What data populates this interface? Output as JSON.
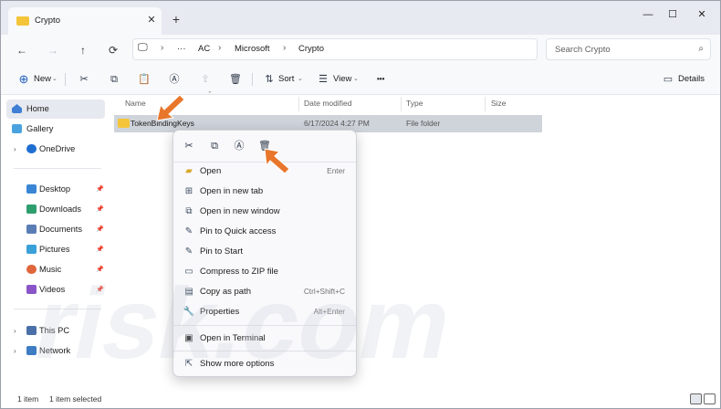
{
  "window": {
    "tab_title": "Crypto",
    "tab_close_glyph": "✕",
    "new_tab_glyph": "+",
    "minimize_glyph": "—",
    "maximize_glyph": "☐",
    "close_glyph": "✕"
  },
  "address": {
    "crumbs": [
      "AC",
      "Microsoft",
      "Crypto"
    ],
    "search_placeholder": "Search Crypto"
  },
  "toolbar": {
    "new_label": "New",
    "sort_label": "Sort",
    "view_label": "View",
    "more_glyph": "•••",
    "details_label": "Details"
  },
  "sidebar": {
    "items": [
      {
        "label": "Home",
        "icon": "home-icon"
      },
      {
        "label": "Gallery",
        "icon": "gallery-icon"
      },
      {
        "label": "OneDrive",
        "icon": "cloud-icon"
      },
      {
        "label": "Desktop",
        "icon": "desktop-icon"
      },
      {
        "label": "Downloads",
        "icon": "download-icon"
      },
      {
        "label": "Documents",
        "icon": "document-icon"
      },
      {
        "label": "Pictures",
        "icon": "picture-icon"
      },
      {
        "label": "Music",
        "icon": "music-icon"
      },
      {
        "label": "Videos",
        "icon": "video-icon"
      },
      {
        "label": "This PC",
        "icon": "pc-icon"
      },
      {
        "label": "Network",
        "icon": "network-icon"
      }
    ]
  },
  "columns": {
    "name": "Name",
    "date": "Date modified",
    "type": "Type",
    "size": "Size"
  },
  "files": [
    {
      "name": "TokenBindingKeys",
      "date": "6/17/2024 4:27 PM",
      "type": "File folder",
      "size": ""
    }
  ],
  "status": {
    "count": "1 item",
    "selected": "1 item selected"
  },
  "context_menu": {
    "top_icons": [
      "cut-icon",
      "copy-icon",
      "rename-icon",
      "delete-icon"
    ],
    "items": [
      {
        "label": "Open",
        "shortcut": "Enter",
        "icon": "open-folder-icon"
      },
      {
        "label": "Open in new tab",
        "shortcut": "",
        "icon": "new-tab-icon"
      },
      {
        "label": "Open in new window",
        "shortcut": "",
        "icon": "new-window-icon"
      },
      {
        "label": "Pin to Quick access",
        "shortcut": "",
        "icon": "pin-icon"
      },
      {
        "label": "Pin to Start",
        "shortcut": "",
        "icon": "pin-icon"
      },
      {
        "label": "Compress to ZIP file",
        "shortcut": "",
        "icon": "zip-icon"
      },
      {
        "label": "Copy as path",
        "shortcut": "Ctrl+Shift+C",
        "icon": "path-icon"
      },
      {
        "label": "Properties",
        "shortcut": "Alt+Enter",
        "icon": "wrench-icon"
      },
      {
        "label": "Open in Terminal",
        "shortcut": "",
        "icon": "terminal-icon"
      },
      {
        "label": "Show more options",
        "shortcut": "",
        "icon": "more-options-icon"
      }
    ]
  },
  "colors": {
    "accent_arrow": "#e8762b",
    "folder": "#f4c53b",
    "selection": "#cfd3da"
  }
}
